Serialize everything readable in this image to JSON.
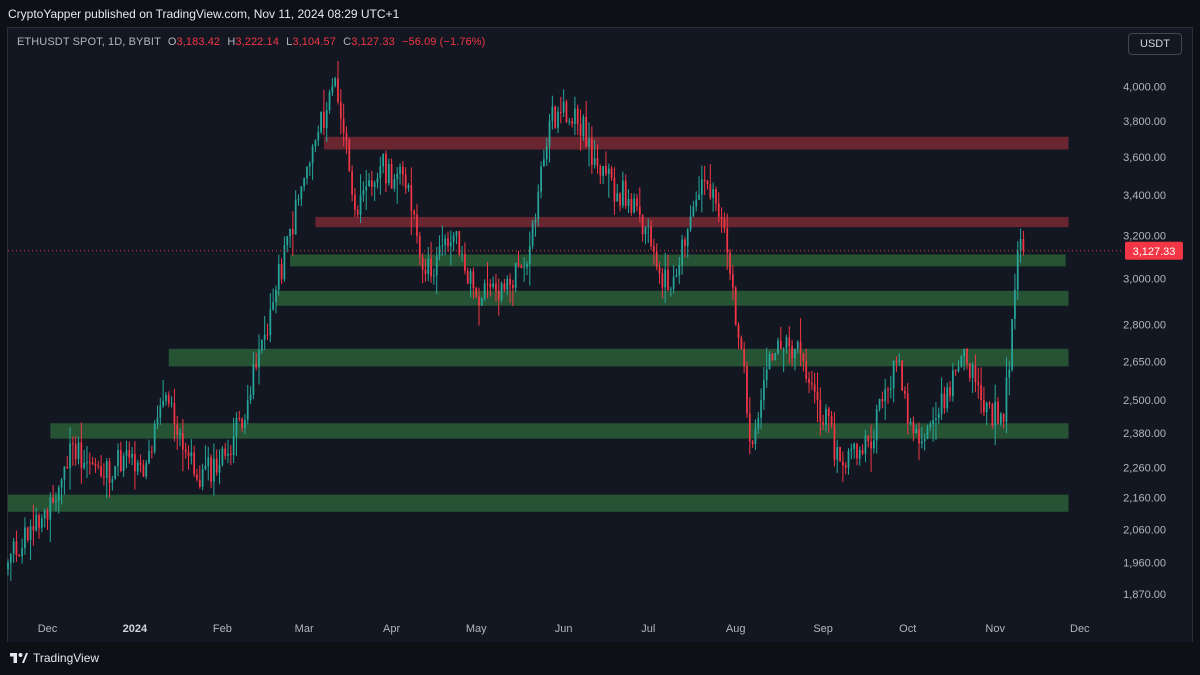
{
  "header": {
    "published_text": "CryptoYapper published on TradingView.com, Nov 11, 2024 08:29 UTC+1"
  },
  "legend": {
    "symbol": "ETHUSDT SPOT, 1D, BYBIT",
    "open_label": "O",
    "open": "3,183.42",
    "high_label": "H",
    "high": "3,222.14",
    "low_label": "L",
    "low": "3,104.57",
    "close_label": "C",
    "close": "3,127.33",
    "change": "−56.09 (−1.76%)"
  },
  "unit_button": "USDT",
  "branding": {
    "label": "TradingView",
    "logo_icon": "tradingview-logo-icon"
  },
  "colors": {
    "up": "#26a69a",
    "down": "#f23645",
    "support_zone": "#2e6b3a",
    "resistance_zone": "#8a2d36",
    "background": "#131722"
  },
  "chart_data": {
    "type": "candlestick",
    "scale": "log",
    "ylim": [
      1820,
      4150
    ],
    "grid": false,
    "y_ticks": [
      1870,
      1960,
      2060,
      2160,
      2260,
      2380,
      2500,
      2650,
      2800,
      3000,
      3200,
      3400,
      3600,
      3800,
      4000
    ],
    "y_tick_labels": [
      "1,870.00",
      "1,960.00",
      "2,060.00",
      "2,160.00",
      "2,260.00",
      "2,380.00",
      "2,500.00",
      "2,650.00",
      "2,800.00",
      "3,000.00",
      "3,200.00",
      "3,400.00",
      "3,600.00",
      "3,800.00",
      "4,000.00"
    ],
    "x_start": "2023-11-17",
    "x_end": "2024-12-11",
    "x_ticks": [
      {
        "date": "2023-12-01",
        "label": "Dec"
      },
      {
        "date": "2024-01-01",
        "label": "2024"
      },
      {
        "date": "2024-02-01",
        "label": "Feb"
      },
      {
        "date": "2024-03-01",
        "label": "Mar"
      },
      {
        "date": "2024-04-01",
        "label": "Apr"
      },
      {
        "date": "2024-05-01",
        "label": "May"
      },
      {
        "date": "2024-06-01",
        "label": "Jun"
      },
      {
        "date": "2024-07-01",
        "label": "Jul"
      },
      {
        "date": "2024-08-01",
        "label": "Aug"
      },
      {
        "date": "2024-09-01",
        "label": "Sep"
      },
      {
        "date": "2024-10-01",
        "label": "Oct"
      },
      {
        "date": "2024-11-01",
        "label": "Nov"
      },
      {
        "date": "2024-12-01",
        "label": "Dec"
      }
    ],
    "last_price": 3127.33,
    "last_price_label": "3,127.33",
    "zones": [
      {
        "kind": "resistance",
        "low": 3640,
        "high": 3710,
        "from": "2024-03-08",
        "to": "2024-11-27"
      },
      {
        "kind": "resistance",
        "low": 3240,
        "high": 3290,
        "from": "2024-03-05",
        "to": "2024-11-27"
      },
      {
        "kind": "support",
        "low": 3055,
        "high": 3110,
        "from": "2024-02-25",
        "to": "2024-11-26"
      },
      {
        "kind": "support",
        "low": 2880,
        "high": 2945,
        "from": "2024-02-20",
        "to": "2024-11-27"
      },
      {
        "kind": "support",
        "low": 2630,
        "high": 2700,
        "from": "2024-01-13",
        "to": "2024-11-27"
      },
      {
        "kind": "support",
        "low": 2360,
        "high": 2415,
        "from": "2023-12-02",
        "to": "2024-11-27"
      },
      {
        "kind": "support",
        "low": 2115,
        "high": 2170,
        "from": "2023-11-17",
        "to": "2024-11-27"
      }
    ],
    "key_closes": [
      {
        "date": "2023-11-17",
        "close": 1960
      },
      {
        "date": "2023-11-25",
        "close": 2070
      },
      {
        "date": "2023-12-01",
        "close": 2090
      },
      {
        "date": "2023-12-10",
        "close": 2340
      },
      {
        "date": "2023-12-20",
        "close": 2230
      },
      {
        "date": "2023-12-28",
        "close": 2300
      },
      {
        "date": "2024-01-04",
        "close": 2230
      },
      {
        "date": "2024-01-12",
        "close": 2520
      },
      {
        "date": "2024-01-23",
        "close": 2220
      },
      {
        "date": "2024-02-02",
        "close": 2300
      },
      {
        "date": "2024-02-10",
        "close": 2500
      },
      {
        "date": "2024-02-20",
        "close": 2950
      },
      {
        "date": "2024-02-28",
        "close": 3380
      },
      {
        "date": "2024-03-12",
        "close": 4050
      },
      {
        "date": "2024-03-20",
        "close": 3300
      },
      {
        "date": "2024-03-28",
        "close": 3550
      },
      {
        "date": "2024-04-07",
        "close": 3450
      },
      {
        "date": "2024-04-13",
        "close": 3020
      },
      {
        "date": "2024-04-23",
        "close": 3200
      },
      {
        "date": "2024-05-01",
        "close": 2920
      },
      {
        "date": "2024-05-11",
        "close": 2950
      },
      {
        "date": "2024-05-20",
        "close": 3150
      },
      {
        "date": "2024-05-27",
        "close": 3800
      },
      {
        "date": "2024-06-05",
        "close": 3870
      },
      {
        "date": "2024-06-14",
        "close": 3500
      },
      {
        "date": "2024-06-24",
        "close": 3380
      },
      {
        "date": "2024-07-02",
        "close": 3150
      },
      {
        "date": "2024-07-08",
        "close": 2950
      },
      {
        "date": "2024-07-20",
        "close": 3480
      },
      {
        "date": "2024-07-27",
        "close": 3280
      },
      {
        "date": "2024-08-03",
        "close": 2700
      },
      {
        "date": "2024-08-06",
        "close": 2350
      },
      {
        "date": "2024-08-13",
        "close": 2680
      },
      {
        "date": "2024-08-22",
        "close": 2700
      },
      {
        "date": "2024-08-30",
        "close": 2500
      },
      {
        "date": "2024-09-07",
        "close": 2280
      },
      {
        "date": "2024-09-17",
        "close": 2350
      },
      {
        "date": "2024-09-27",
        "close": 2650
      },
      {
        "date": "2024-10-03",
        "close": 2380
      },
      {
        "date": "2024-10-12",
        "close": 2450
      },
      {
        "date": "2024-10-21",
        "close": 2700
      },
      {
        "date": "2024-10-27",
        "close": 2500
      },
      {
        "date": "2024-11-04",
        "close": 2420
      },
      {
        "date": "2024-11-08",
        "close": 2950
      },
      {
        "date": "2024-11-10",
        "close": 3183.42
      },
      {
        "date": "2024-11-11",
        "close": 3127.33
      }
    ]
  }
}
